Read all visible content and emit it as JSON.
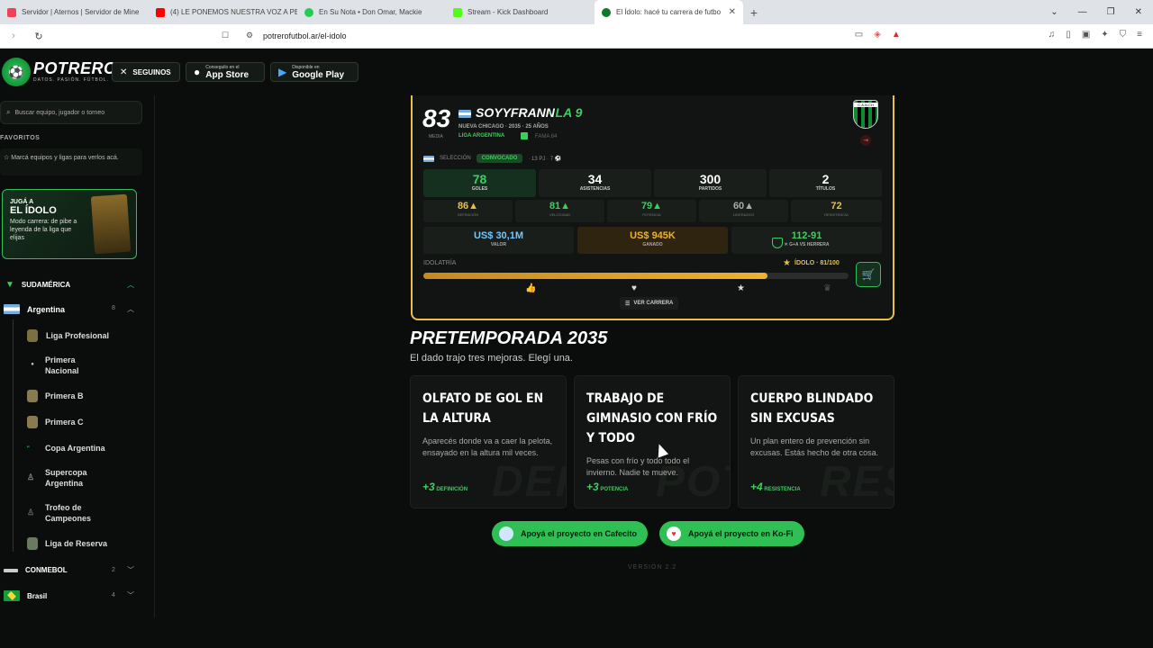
{
  "browser": {
    "tabs": [
      {
        "label": "Servidor | Aternos | Servidor de Mine",
        "color": "#e45"
      },
      {
        "label": "(4) LE PONEMOS NUESTRA VOZ A PE",
        "color": "#f00"
      },
      {
        "label": "En Su Nota • Don Omar, Mackie",
        "color": "#2c5"
      },
      {
        "label": "Stream - Kick Dashboard",
        "color": "#53fc18"
      },
      {
        "label": "El Ídolo: hacé tu carrera de futbo",
        "color": "#0c7a2e"
      }
    ],
    "url": "potrerofutbol.ar/el-idolo"
  },
  "header": {
    "brand": "POTRERO",
    "tagline": "DATOS. PASIÓN. FÚTBOL.",
    "follow": "SEGUINOS",
    "appstore_small": "Conseguilo en el",
    "appstore_big": "App Store",
    "gplay_small": "Disponible en",
    "gplay_big": "Google Play"
  },
  "sidebar": {
    "search_placeholder": "Buscar equipo, jugador o torneo",
    "favorites_title": "FAVORITOS",
    "favorites_hint": "Marcá equipos y ligas para verlos acá.",
    "promo": {
      "t1": "JUGÁ A",
      "t2": "EL ÍDOLO",
      "t3": "Modo carrera: de pibe a leyenda de la liga que elijas"
    },
    "region": "SUDAMÉRICA",
    "country": "Argentina",
    "country_count": "8",
    "leagues": [
      "Liga Profesional",
      "Primera Nacional",
      "Primera B",
      "Primera C",
      "Copa Argentina",
      "Supercopa Argentina",
      "Trofeo de Campeones",
      "Liga de Reserva"
    ],
    "conmebol": "CONMEBOL",
    "conmebol_count": "2",
    "brasil": "Brasil",
    "brasil_count": "4"
  },
  "player": {
    "rating": "83",
    "rating_label": "MEDIA",
    "name": "SOYYFRANN",
    "position": "· LA 9",
    "meta": "NUEVA CHICAGO · 2035 · 25 AÑOS",
    "league": "LIGA ARGENTINA",
    "fama": "FAMA 84",
    "crest_text": "C.A.N.CH",
    "seleccion": "SELECCIÓN",
    "convocado": "CONVOCADO",
    "seleccion_stats": "· 13 PJ · 7 ⚽",
    "stats": [
      {
        "v": "78",
        "l": "GOLES"
      },
      {
        "v": "34",
        "l": "ASISTENCIAS"
      },
      {
        "v": "300",
        "l": "PARTIDOS"
      },
      {
        "v": "2",
        "l": "TÍTULOS"
      }
    ],
    "attrs": [
      {
        "v": "86▲",
        "l": "DEFINICIÓN",
        "c": "#e9c046"
      },
      {
        "v": "81▲",
        "l": "VELOCIDAD",
        "c": "#3ccf5f"
      },
      {
        "v": "79▲",
        "l": "POTENCIA",
        "c": "#3ccf5f"
      },
      {
        "v": "60▲",
        "l": "LIDERAZGO",
        "c": "#aaaaaa"
      },
      {
        "v": "72",
        "l": "RESISTENCIA",
        "c": "#e9c046"
      }
    ],
    "valor": "US$ 30,1M",
    "valor_label": "VALOR",
    "ganado": "US$ 945K",
    "ganado_label": "GANADO",
    "h2h": "112-91",
    "h2h_label": "✕ G+A VS HERRERA",
    "idolatria_label": "IDOLATRÍA",
    "idolatria_value": "ÍDOLO · 81/100",
    "idolatria_fraction": 0.81,
    "ver_carrera": "VER CARRERA"
  },
  "preseason": {
    "title": "PRETEMPORADA 2035",
    "subtitle": "El dado trajo tres mejoras. Elegí una.",
    "options": [
      {
        "title": "OLFATO DE GOL EN LA ALTURA",
        "desc": "Aparecés donde va a caer la pelota, ensayado en la altura mil veces.",
        "bonus": "+3",
        "attr": "DEFINICIÓN",
        "water": "DEF"
      },
      {
        "title": "TRABAJO DE GIMNASIO CON FRÍO Y TODO",
        "desc": "Pesas con frío y todo todo el invierno. Nadie te mueve.",
        "bonus": "+3",
        "attr": "POTENCIA",
        "water": "POT"
      },
      {
        "title": "CUERPO BLINDADO SIN EXCUSAS",
        "desc": "Un plan entero de prevención sin excusas. Estás hecho de otra cosa.",
        "bonus": "+4",
        "attr": "RESISTENCIA",
        "water": "RES"
      }
    ]
  },
  "footer": {
    "cafecito": "Apoyá el proyecto en Cafecito",
    "kofi": "Apoyá el proyecto en Ko-Fi",
    "version": "VERSIÓN 2.2"
  }
}
